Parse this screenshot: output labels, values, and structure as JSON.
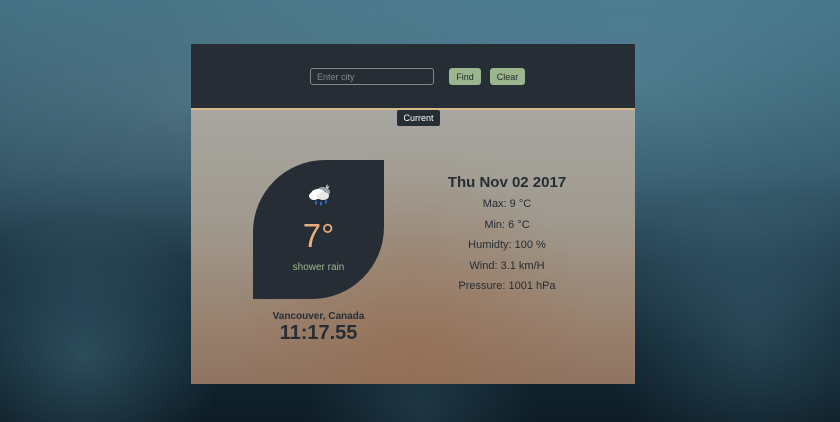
{
  "search": {
    "placeholder": "Enter city",
    "find_label": "Find",
    "clear_label": "Clear"
  },
  "tabs": {
    "current_label": "Current"
  },
  "current": {
    "icon": "shower-rain-cloud-icon",
    "temperature": "7°",
    "description": "shower rain",
    "location": "Vancouver, Canada",
    "time": "11:17.55",
    "date": "Thu Nov 02 2017",
    "max": "Max: 9 °C",
    "min": "Min: 6 °C",
    "humidity": "Humidty: 100 %",
    "wind": "Wind: 3.1 km/H",
    "pressure": "Pressure: 1001 hPa"
  },
  "colors": {
    "header_bg": "#262d34",
    "accent_green": "#9bb68e",
    "temperature": "#e8ae7d",
    "header_border": "#d8b98a"
  }
}
